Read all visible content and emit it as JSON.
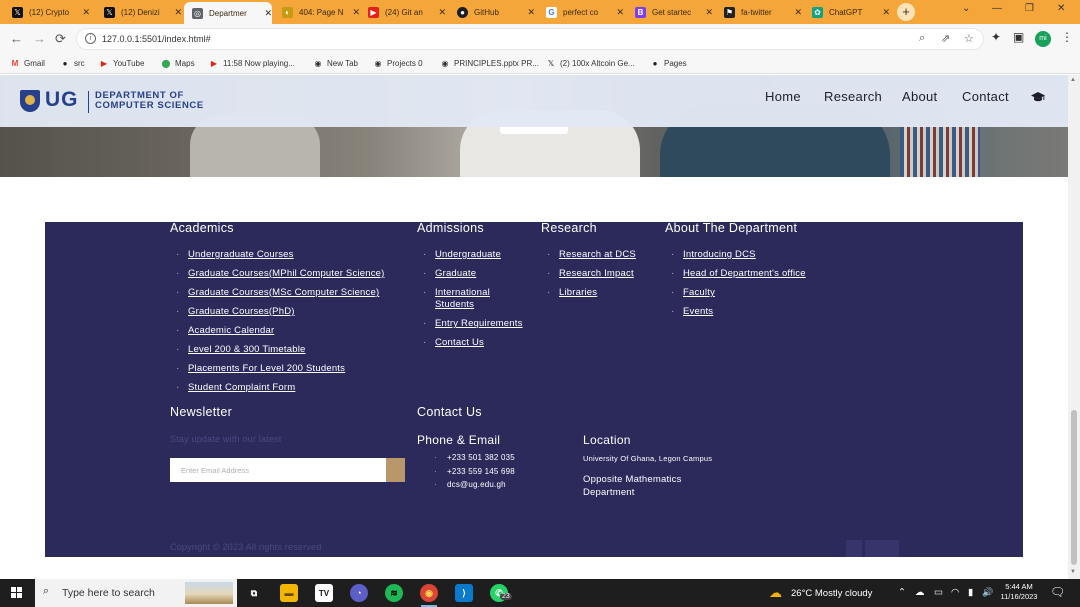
{
  "browser": {
    "tabs": [
      {
        "title": "(12) Crypto",
        "icon": "x-logo-icon",
        "color": "#111111",
        "glyph": "𝕏"
      },
      {
        "title": "(12) Denizi",
        "icon": "x-logo-icon",
        "color": "#111111",
        "glyph": "𝕏"
      },
      {
        "title": "Departmer",
        "icon": "globe-icon",
        "color": "#5f6368",
        "glyph": "◎",
        "active": true
      },
      {
        "title": "404: Page N",
        "icon": "page-404-icon",
        "color": "#c89a12",
        "glyph": "◐"
      },
      {
        "title": "(24) Git an",
        "icon": "youtube-icon",
        "color": "#e62117",
        "glyph": "▶"
      },
      {
        "title": "GitHub",
        "icon": "github-icon",
        "color": "#1b1f23",
        "glyph": "●"
      },
      {
        "title": "perfect co",
        "icon": "google-icon",
        "color": "#4285f4",
        "glyph": "G"
      },
      {
        "title": "Get startec",
        "icon": "bootstrap-icon",
        "color": "#7b3ff2",
        "glyph": "B"
      },
      {
        "title": "fa-twitter",
        "icon": "flag-icon",
        "color": "#222222",
        "glyph": "⚑"
      },
      {
        "title": "ChatGPT",
        "icon": "chatgpt-icon",
        "color": "#10a37f",
        "glyph": "✿"
      }
    ],
    "tab_close_glyph": "✕",
    "new_tab_glyph": "+",
    "window_controls": [
      "⌄",
      "—",
      "❐",
      "✕"
    ],
    "url": "127.0.0.1:5501/index.html#",
    "nav": {
      "back": "←",
      "forward": "→",
      "reload": "⟳"
    },
    "omnibox_icons": [
      "⌕",
      "⇗",
      "☆"
    ],
    "toolbar_icons": [
      "✦",
      "▣",
      "⋮"
    ],
    "profile_initials": "mi",
    "bookmarks": [
      {
        "label": "Gmail",
        "icon": "gmail-icon",
        "glyph": "M",
        "color": "#ea4335"
      },
      {
        "label": "src",
        "icon": "github-icon",
        "glyph": "●",
        "color": "#1b1f23"
      },
      {
        "label": "YouTube",
        "icon": "youtube-icon",
        "glyph": "▶",
        "color": "#e62117"
      },
      {
        "label": "Maps",
        "icon": "maps-icon",
        "glyph": "⬤",
        "color": "#34a853"
      },
      {
        "label": "11:58 Now playing...",
        "icon": "youtube-icon",
        "glyph": "▶",
        "color": "#e62117"
      },
      {
        "label": "New Tab",
        "icon": "globe-icon",
        "glyph": "◉",
        "color": "#333333"
      },
      {
        "label": "Projects 0",
        "icon": "globe-icon",
        "glyph": "◉",
        "color": "#333333"
      },
      {
        "label": "PRINCIPLES.pptx PR...",
        "icon": "globe-icon",
        "glyph": "◉",
        "color": "#333333"
      },
      {
        "label": "(2) 100x Altcoin Ge...",
        "icon": "x-logo-icon",
        "glyph": "𝕏",
        "color": "#111111"
      },
      {
        "label": "Pages",
        "icon": "github-icon",
        "glyph": "●",
        "color": "#1b1f23"
      }
    ]
  },
  "site": {
    "logo": {
      "short": "UG",
      "line1": "DEPARTMENT OF",
      "line2": "COMPUTER SCIENCE"
    },
    "nav": [
      "Home",
      "Research",
      "About",
      "Contact"
    ],
    "footer": {
      "academics": {
        "heading": "Academics",
        "links": [
          "Undergraduate Courses",
          "Graduate Courses(MPhil Computer Science)",
          "Graduate Courses(MSc Computer Science)",
          "Graduate Courses(PhD)",
          "Academic Calendar",
          "Level 200 & 300 Timetable",
          "Placements For Level 200 Students",
          "Student Complaint Form"
        ]
      },
      "admissions": {
        "heading": "Admissions",
        "links": [
          "Undergraduate",
          "Graduate",
          "International Students",
          "Entry Requirements",
          "Contact Us"
        ]
      },
      "research": {
        "heading": "Research",
        "links": [
          "Research at DCS",
          "Research Impact",
          "Libraries"
        ]
      },
      "about": {
        "heading": "About The Department",
        "links": [
          "Introducing DCS",
          "Head of Department's office",
          "Faculty",
          "Events"
        ]
      },
      "newsletter": {
        "heading": "Newsletter",
        "text": "Stay update with our latest",
        "placeholder": "Enter Email Address"
      },
      "contact": {
        "heading": "Contact Us",
        "phone_email_heading": "Phone & Email",
        "items": [
          "+233 501 382 035",
          "+233 559 145 698",
          "dcs@ug.edu.gh"
        ],
        "location_heading": "Location",
        "location_line1": "University Of Ghana, Legon Campus",
        "location_line2": "Opposite Mathematics Department"
      },
      "copyright": "Copyright © 2023 All rights reserved"
    }
  },
  "taskbar": {
    "search_placeholder": "Type here to search",
    "apps": [
      {
        "name": "task-view-icon",
        "glyph": "⧉",
        "color": "#1e1e1e"
      },
      {
        "name": "file-explorer-icon",
        "glyph": "▬",
        "color": "#f2b705"
      },
      {
        "name": "tradingview-icon",
        "glyph": "TV",
        "color": "#131722"
      },
      {
        "name": "app-icon",
        "glyph": "◔",
        "color": "#5b5fc7"
      },
      {
        "name": "spotify-icon",
        "glyph": "≋",
        "color": "#1db954"
      },
      {
        "name": "chrome-icon",
        "glyph": "◉",
        "color": "#db4437",
        "active": true
      },
      {
        "name": "vscode-icon",
        "glyph": "⟩",
        "color": "#0a7acc"
      },
      {
        "name": "whatsapp-icon",
        "glyph": "✆",
        "color": "#25d366"
      }
    ],
    "whatsapp_badge": "23",
    "weather": "26°C  Mostly cloudy",
    "tray_icons": [
      "⌃",
      "☁",
      "▭",
      "◠",
      "▮",
      "🔊"
    ],
    "time": "5:44 AM",
    "date": "11/16/2023"
  },
  "colors": {
    "footer_bg": "#2c2a5b",
    "header_bg": "#e2e8f4",
    "brand": "#27408b",
    "tabstrip": "#f5a63a",
    "newsletter_button": "#b8976a"
  }
}
